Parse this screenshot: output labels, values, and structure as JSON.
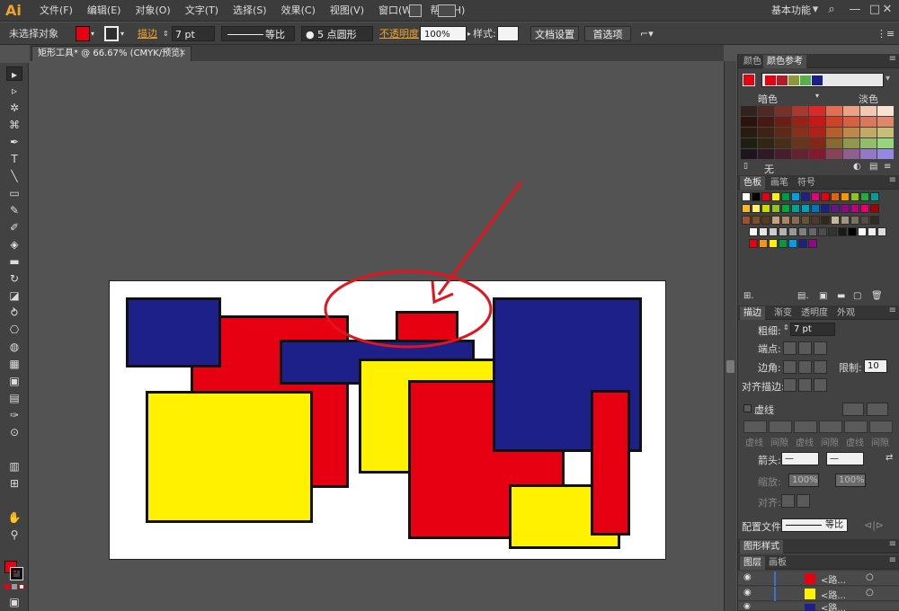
{
  "app": {
    "logo": "Ai"
  },
  "menu": [
    "文件(F)",
    "编辑(E)",
    "对象(O)",
    "文字(T)",
    "选择(S)",
    "效果(C)",
    "视图(V)",
    "窗口(W)",
    "帮助(H)"
  ],
  "workspace": {
    "label": "基本功能",
    "chevron": "▾",
    "search": "⌕",
    "minimize": "—",
    "restore": "□",
    "close": "✕"
  },
  "control": {
    "no_selection": "未选择对象",
    "stroke_label": "描边",
    "stroke_weight": "7 pt",
    "stroke_profile": "等比",
    "brush": "● 5 点圆形",
    "opacity_label": "不透明度",
    "opacity_value": "100%",
    "style_label": "样式:",
    "doc_settings": "文档设置",
    "preferences": "首选项",
    "fill_color": "#e60012"
  },
  "document": {
    "tab_title": "矩形工具* @ 66.67% (CMYK/预览)",
    "close": "✕"
  },
  "tools": [
    "▸",
    "▹",
    "✲",
    "⌘",
    "✒",
    "T",
    "╲",
    "▭",
    "✎",
    "✐",
    "◈",
    "▬",
    "↻",
    "◪",
    "⥁",
    "⎔",
    "◍",
    "▦",
    "▣",
    "▤",
    "✑",
    "⊙",
    "▥",
    "⊞",
    "✋",
    "⚲"
  ],
  "color_guide": {
    "tab_color": "颜色",
    "tab_guide": "颜色参考",
    "dark_label": "暗色",
    "light_label": "淡色",
    "none_label": "无",
    "base_colors": [
      "#e60012",
      "#b01d2a",
      "#8a9a3a",
      "#58b04a",
      "#1d2088"
    ]
  },
  "swatches": {
    "tab_swatches": "色板",
    "tab_brushes": "画笔",
    "tab_symbols": "符号"
  },
  "stroke_panel": {
    "tab_stroke": "描边",
    "tab_gradient": "渐变",
    "tab_transparency": "透明度",
    "tab_appearance": "外观",
    "weight_label": "粗细:",
    "weight_value": "7 pt",
    "cap_label": "端点:",
    "corner_label": "边角:",
    "limit_label": "限制:",
    "limit_value": "10",
    "align_label": "对齐描边:",
    "dashed_label": "虚线",
    "dash_labels": [
      "虚线",
      "间隙",
      "虚线",
      "间隙",
      "虚线",
      "间隙"
    ],
    "arrow_label": "箭头:",
    "scale_label": "缩放:",
    "scale_a": "100%",
    "scale_b": "100%",
    "align2_label": "对齐:",
    "profile_label": "配置文件:",
    "profile_value": "等比"
  },
  "graphic_styles": {
    "tab": "图形样式"
  },
  "layers": {
    "tab_layers": "图层",
    "tab_artboards": "画板",
    "rows": [
      {
        "name": "<路...",
        "color": "#e60012"
      },
      {
        "name": "<路...",
        "color": "#fff100"
      },
      {
        "name": "<路...",
        "color": "#1d2088"
      }
    ]
  },
  "artwork_colors": {
    "blue": "#1d2088",
    "red": "#e60012",
    "yellow": "#fff100",
    "annotation": "#e3141b"
  }
}
